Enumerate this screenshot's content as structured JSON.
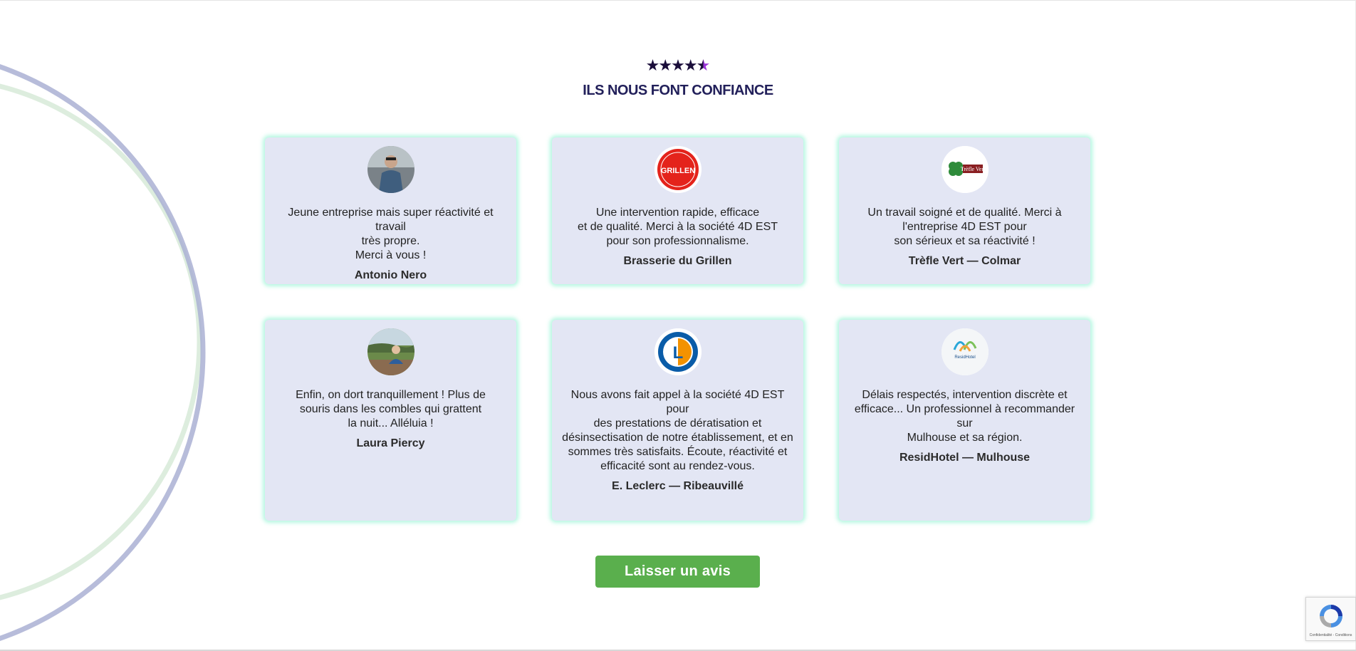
{
  "rating": {
    "stars": 4.5,
    "max": 5
  },
  "section": {
    "title": "ILS NOUS FONT CONFIANCE"
  },
  "testimonials": [
    {
      "quote": "Jeune entreprise mais super réactivité et travail\ntrès propre.\nMerci à vous !",
      "author": "Antonio Nero"
    },
    {
      "quote": "Une intervention rapide, efficace\net de qualité. Merci à la société 4D EST\npour son professionnalisme.",
      "author": "Brasserie du Grillen",
      "logo_text": "GRILLEN"
    },
    {
      "quote": "Un travail soigné et de qualité. Merci à\nl'entreprise 4D EST pour\nson sérieux et sa réactivité !",
      "author": "Trèfle Vert — Colmar",
      "logo_text": "Trèfle Vert"
    },
    {
      "quote": "Enfin, on dort tranquillement ! Plus de\nsouris dans les combles qui grattent\nla nuit... Alléluia !",
      "author": "Laura Piercy"
    },
    {
      "quote": "Nous avons fait appel à la société 4D EST pour\ndes prestations de dératisation et\ndésinsectisation de notre établissement, et en\nsommes très satisfaits. Écoute, réactivité et\nefficacité sont au rendez-vous.",
      "author": "E. Leclerc — Ribeauvillé",
      "logo_text": "L"
    },
    {
      "quote": "Délais respectés, intervention discrète et\nefficace... Un professionnel à recommander sur\nMulhouse et sa région.",
      "author": "ResidHotel — Mulhouse",
      "logo_text": "ResidHotel"
    }
  ],
  "cta": {
    "label": "Laisser un avis"
  },
  "recaptcha": {
    "legal": "Confidentialité - Conditions"
  },
  "colors": {
    "accent": "#5aaf4d",
    "title": "#22205a",
    "card": "#e3e6f4",
    "glow": "#78f0c8"
  }
}
